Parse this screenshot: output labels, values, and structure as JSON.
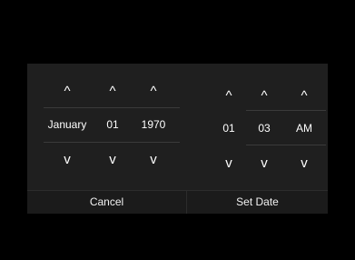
{
  "date_picker": {
    "month": {
      "up": "^",
      "value": "January",
      "down": "v"
    },
    "day": {
      "up": "^",
      "value": "01",
      "down": "v"
    },
    "year": {
      "up": "^",
      "value": "1970",
      "down": "v"
    }
  },
  "time_picker": {
    "hour": {
      "up": "^",
      "value": "01",
      "down": "v"
    },
    "minute": {
      "up": "^",
      "value": "03",
      "down": "v"
    },
    "period": {
      "up": "^",
      "value": "AM",
      "down": "v"
    }
  },
  "footer": {
    "cancel_label": "Cancel",
    "set_label": "Set Date"
  },
  "colors": {
    "background": "#000000",
    "dialog": "#1f1f1f",
    "text": "#ffffff"
  }
}
